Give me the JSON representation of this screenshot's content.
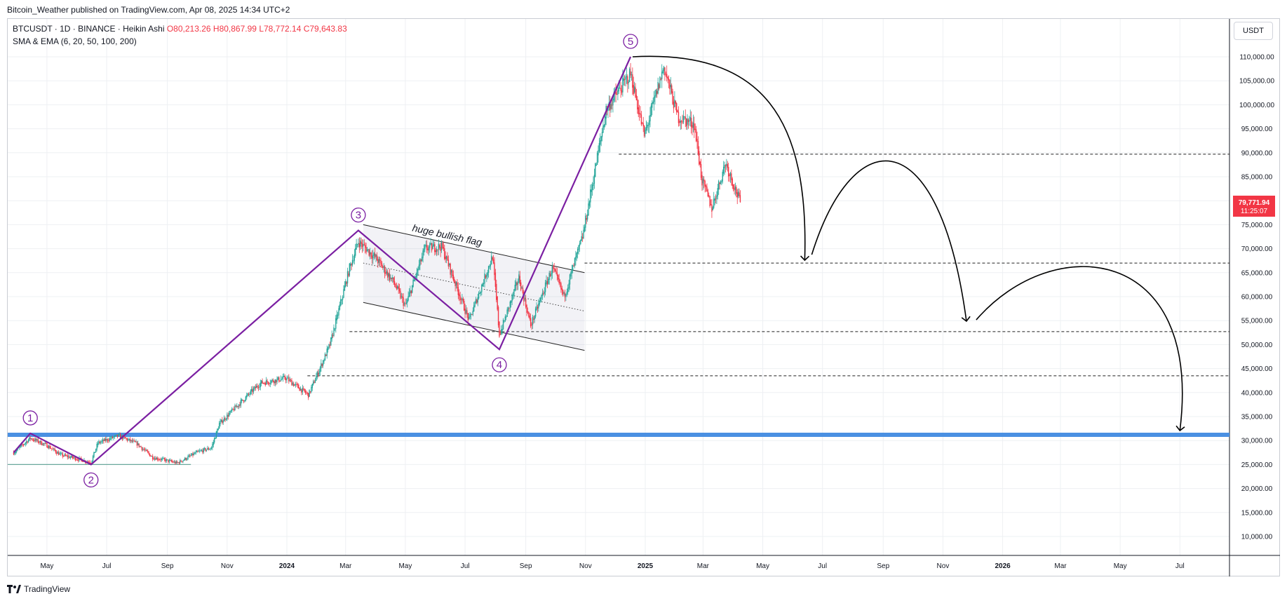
{
  "header": {
    "publisher_line": "Bitcoin_Weather published on TradingView.com, Apr 08, 2025 14:34 UTC+2"
  },
  "legend": {
    "symbol": "BTCUSDT · 1D · BINANCE · Heikin Ashi",
    "open": "O80,213.26",
    "high": "H80,867.99",
    "low": "L78,772.14",
    "close": "C79,643.83",
    "indicator": "SMA & EMA (6, 20, 50, 100, 200)"
  },
  "price_axis": {
    "unit": "USDT",
    "last_price": "79,771.94",
    "countdown": "11:25:07"
  },
  "footer": {
    "brand": "TradingView"
  },
  "colors": {
    "up": "#26a69a",
    "down": "#f23645",
    "wave": "#7b1fa2",
    "support_band": "#4a90e2",
    "last_price_bg": "#f23645"
  },
  "chart_data": {
    "type": "candlestick",
    "title": "",
    "price_type": "Heikin Ashi daily",
    "ylim": [
      6000,
      114000
    ],
    "y_ticks": [
      110000,
      105000,
      100000,
      95000,
      90000,
      85000,
      80000,
      75000,
      70000,
      65000,
      60000,
      55000,
      50000,
      45000,
      40000,
      35000,
      30000,
      25000,
      20000,
      15000,
      10000
    ],
    "y_tick_labels": [
      "110,000.00",
      "105,000.00",
      "100,000.00",
      "95,000.00",
      "90,000.00",
      "85,000.00",
      "80,000.00",
      "75,000.00",
      "70,000.00",
      "65,000.00",
      "60,000.00",
      "55,000.00",
      "50,000.00",
      "45,000.00",
      "40,000.00",
      "35,000.00",
      "30,000.00",
      "25,000.00",
      "20,000.00",
      "15,000.00",
      "10,000.00"
    ],
    "x_range": [
      "2023-03-28",
      "2026-08-15"
    ],
    "x_ticks": [
      {
        "label": "May",
        "date": "2023-05-01",
        "bold": false
      },
      {
        "label": "Jul",
        "date": "2023-07-01",
        "bold": false
      },
      {
        "label": "Sep",
        "date": "2023-09-01",
        "bold": false
      },
      {
        "label": "Nov",
        "date": "2023-11-01",
        "bold": false
      },
      {
        "label": "2024",
        "date": "2024-01-01",
        "bold": true
      },
      {
        "label": "Mar",
        "date": "2024-03-01",
        "bold": false
      },
      {
        "label": "May",
        "date": "2024-05-01",
        "bold": false
      },
      {
        "label": "Jul",
        "date": "2024-07-01",
        "bold": false
      },
      {
        "label": "Sep",
        "date": "2024-09-01",
        "bold": false
      },
      {
        "label": "Nov",
        "date": "2024-11-01",
        "bold": false
      },
      {
        "label": "2025",
        "date": "2025-01-01",
        "bold": true
      },
      {
        "label": "Mar",
        "date": "2025-03-01",
        "bold": false
      },
      {
        "label": "May",
        "date": "2025-05-01",
        "bold": false
      },
      {
        "label": "Jul",
        "date": "2025-07-01",
        "bold": false
      },
      {
        "label": "Sep",
        "date": "2025-09-01",
        "bold": false
      },
      {
        "label": "Nov",
        "date": "2025-11-01",
        "bold": false
      },
      {
        "label": "2026",
        "date": "2026-01-01",
        "bold": true
      },
      {
        "label": "Mar",
        "date": "2026-03-01",
        "bold": false
      },
      {
        "label": "May",
        "date": "2026-05-01",
        "bold": false
      },
      {
        "label": "Jul",
        "date": "2026-07-01",
        "bold": false
      }
    ],
    "price_path": [
      [
        "2023-03-28",
        27500
      ],
      [
        "2023-04-14",
        30500
      ],
      [
        "2023-05-01",
        29000
      ],
      [
        "2023-05-15",
        27000
      ],
      [
        "2023-06-15",
        25500
      ],
      [
        "2023-06-22",
        29500
      ],
      [
        "2023-07-13",
        31000
      ],
      [
        "2023-08-01",
        29300
      ],
      [
        "2023-08-17",
        26500
      ],
      [
        "2023-09-11",
        25300
      ],
      [
        "2023-10-01",
        27500
      ],
      [
        "2023-10-16",
        28500
      ],
      [
        "2023-10-24",
        33500
      ],
      [
        "2023-11-10",
        37000
      ],
      [
        "2023-12-05",
        42000
      ],
      [
        "2023-12-31",
        43000
      ],
      [
        "2024-01-23",
        39500
      ],
      [
        "2024-02-14",
        50000
      ],
      [
        "2024-03-05",
        66000
      ],
      [
        "2024-03-14",
        71500
      ],
      [
        "2024-04-01",
        68000
      ],
      [
        "2024-04-19",
        63000
      ],
      [
        "2024-05-01",
        58000
      ],
      [
        "2024-05-21",
        70000
      ],
      [
        "2024-06-07",
        70500
      ],
      [
        "2024-07-05",
        55000
      ],
      [
        "2024-07-29",
        68500
      ],
      [
        "2024-08-05",
        52000
      ],
      [
        "2024-08-25",
        64000
      ],
      [
        "2024-09-06",
        54000
      ],
      [
        "2024-09-28",
        66000
      ],
      [
        "2024-10-10",
        60000
      ],
      [
        "2024-10-29",
        72500
      ],
      [
        "2024-11-12",
        88000
      ],
      [
        "2024-11-22",
        99000
      ],
      [
        "2024-12-17",
        106500
      ],
      [
        "2024-12-31",
        93500
      ],
      [
        "2025-01-20",
        108000
      ],
      [
        "2025-02-03",
        97500
      ],
      [
        "2025-02-20",
        96000
      ],
      [
        "2025-02-28",
        84000
      ],
      [
        "2025-03-10",
        78500
      ],
      [
        "2025-03-24",
        88000
      ],
      [
        "2025-04-01",
        83500
      ],
      [
        "2025-04-08",
        79643
      ]
    ],
    "wave_labels": [
      {
        "label": "1",
        "date": "2023-04-14",
        "price": 31500
      },
      {
        "label": "2",
        "date": "2023-06-15",
        "price": 25000
      },
      {
        "label": "3",
        "date": "2024-03-14",
        "price": 73800
      },
      {
        "label": "4",
        "date": "2024-08-05",
        "price": 49000
      },
      {
        "label": "5",
        "date": "2024-12-17",
        "price": 110000
      }
    ],
    "flag_channel": {
      "upper": [
        [
          "2024-03-19",
          75000
        ],
        [
          "2024-10-31",
          65000
        ]
      ],
      "lower": [
        [
          "2024-03-19",
          58800
        ],
        [
          "2024-10-31",
          48800
        ]
      ],
      "mid": [
        [
          "2024-03-19",
          67000
        ],
        [
          "2024-10-31",
          57000
        ]
      ]
    },
    "horizontal_levels": [
      89700,
      67000,
      52700,
      43500
    ],
    "support_band": 31200,
    "base_line": 25000,
    "projection_path": [
      [
        "2025-01-01",
        110000
      ],
      [
        "2025-06-10",
        67000
      ],
      [
        "2025-09-01",
        88000
      ],
      [
        "2025-11-25",
        54000
      ],
      [
        "2026-04-01",
        65000
      ],
      [
        "2026-07-01",
        31500
      ]
    ],
    "annotations": [
      "huge bullish flag"
    ]
  }
}
